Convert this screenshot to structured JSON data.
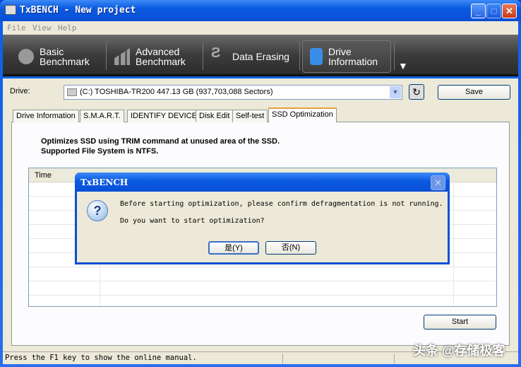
{
  "window": {
    "title": "TxBENCH - New project"
  },
  "menu": [
    "File",
    "View",
    "Help"
  ],
  "toolbar": {
    "items": [
      {
        "l1": "Basic",
        "l2": "Benchmark"
      },
      {
        "l1": "Advanced",
        "l2": "Benchmark"
      },
      {
        "l1": "Data Erasing",
        "l2": ""
      },
      {
        "l1": "Drive",
        "l2": "Information"
      }
    ]
  },
  "drive": {
    "label": "Drive:",
    "value": "(C:) TOSHIBA-TR200  447.13 GB (937,703,088 Sectors)",
    "save": "Save"
  },
  "tabs": [
    "Drive Information",
    "S.M.A.R.T.",
    "IDENTIFY DEVICE",
    "Disk Edit",
    "Self-test",
    "SSD Optimization"
  ],
  "panel": {
    "desc1": "Optimizes SSD using TRIM command at unused area of the SSD.",
    "desc2": "Supported File System is NTFS.",
    "col_time": "Time",
    "start": "Start"
  },
  "status": "Press the F1 key to show the online manual.",
  "dialog": {
    "title": "TxBENCH",
    "line1": "Before starting optimization, please confirm defragmentation is not running.",
    "line2": "Do you want to start optimization?",
    "yes": "是(Y)",
    "no": "否(N)"
  },
  "watermark": "头条 @存储极客"
}
